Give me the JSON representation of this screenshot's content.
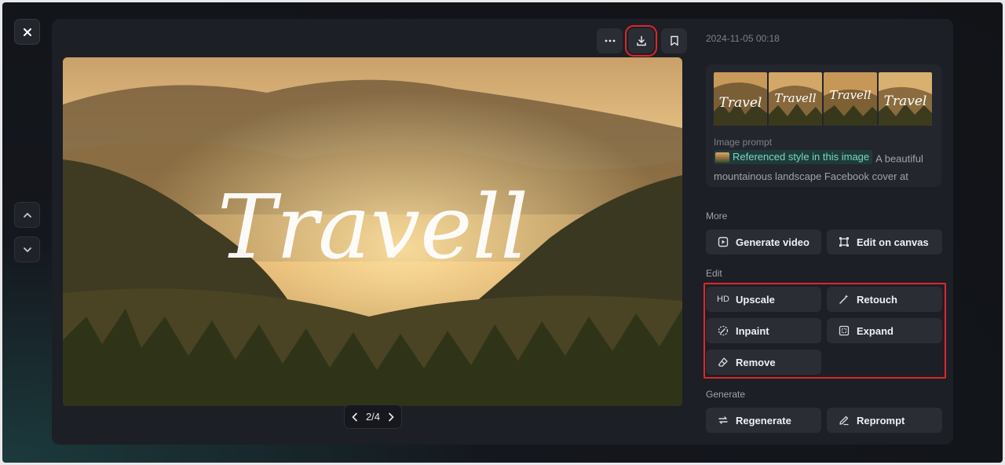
{
  "viewer": {
    "page_indicator": "2/4",
    "main_image_text": "Travell"
  },
  "toolbar": {
    "more_icon": "more-horizontal-icon",
    "download_icon": "download-icon",
    "bookmark_icon": "bookmark-icon"
  },
  "info": {
    "timestamp": "2024-11-05 00:18",
    "thumbnail_texts": [
      "Travel",
      "Travell",
      "Travell",
      "Travel"
    ],
    "prompt_label": "Image prompt",
    "reference_chip": "Referenced style in this image",
    "prompt_text": "A beautiful mountainous landscape Facebook cover at sunset or"
  },
  "sections": {
    "more": {
      "label": "More",
      "buttons": [
        {
          "label": "Generate video",
          "icon": "generate-video-icon"
        },
        {
          "label": "Edit on canvas",
          "icon": "canvas-icon"
        }
      ]
    },
    "edit": {
      "label": "Edit",
      "buttons": [
        {
          "label": "Upscale",
          "icon_text": "HD"
        },
        {
          "label": "Retouch",
          "icon": "magic-wand-icon"
        },
        {
          "label": "Inpaint",
          "icon": "inpaint-icon"
        },
        {
          "label": "Expand",
          "icon": "expand-icon"
        },
        {
          "label": "Remove",
          "icon": "eraser-icon"
        }
      ]
    },
    "generate": {
      "label": "Generate",
      "buttons": [
        {
          "label": "Regenerate",
          "icon": "regenerate-icon"
        },
        {
          "label": "Reprompt",
          "icon": "pencil-icon"
        }
      ]
    }
  },
  "colors": {
    "panel_bg": "#1c1f25",
    "button_bg": "#2a2d34",
    "highlight_red": "#e0262a",
    "chip_teal": "#7fd3c4"
  }
}
